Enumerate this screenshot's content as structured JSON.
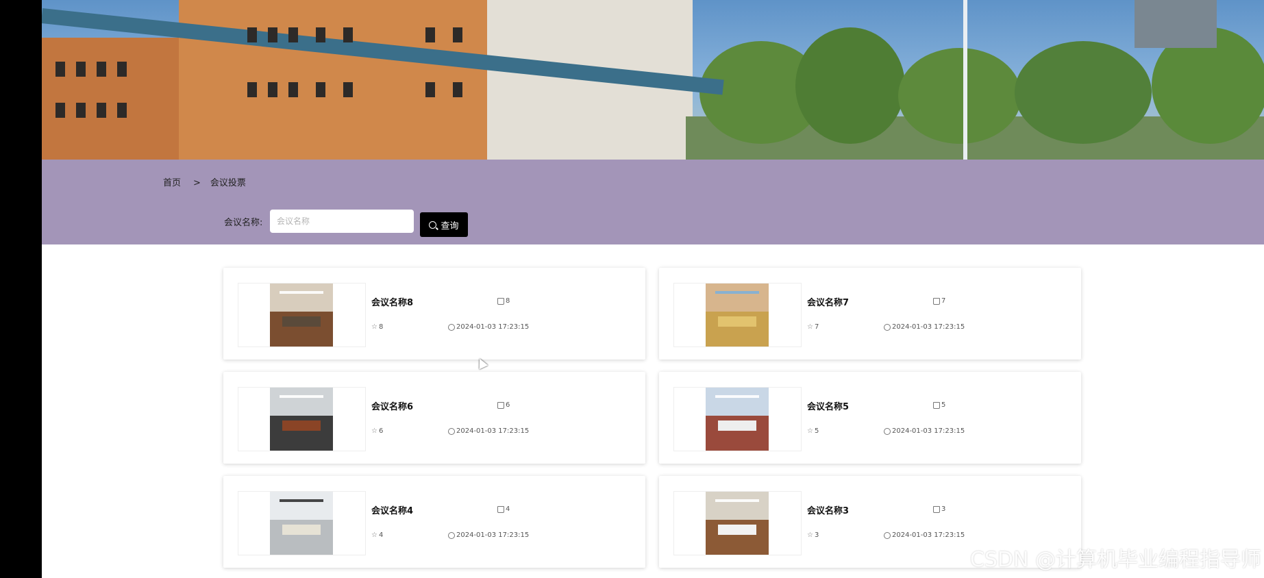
{
  "breadcrumb": {
    "home": "首页",
    "separator": ">",
    "current": "会议投票"
  },
  "search": {
    "label": "会议名称:",
    "placeholder": "会议名称",
    "value": "",
    "button_label": "查询"
  },
  "cards": [
    {
      "title": "会议名称8",
      "likes": "8",
      "favorites": "8",
      "time": "2024-01-03 17:23:15"
    },
    {
      "title": "会议名称7",
      "likes": "7",
      "favorites": "7",
      "time": "2024-01-03 17:23:15"
    },
    {
      "title": "会议名称6",
      "likes": "6",
      "favorites": "6",
      "time": "2024-01-03 17:23:15"
    },
    {
      "title": "会议名称5",
      "likes": "5",
      "favorites": "5",
      "time": "2024-01-03 17:23:15"
    },
    {
      "title": "会议名称4",
      "likes": "4",
      "favorites": "4",
      "time": "2024-01-03 17:23:15"
    },
    {
      "title": "会议名称3",
      "likes": "3",
      "favorites": "3",
      "time": "2024-01-03 17:23:15"
    }
  ],
  "watermark": "CSDN @计算机毕业编程指导师",
  "colors": {
    "header_bg": "#a395b8",
    "button_bg": "#000000"
  }
}
